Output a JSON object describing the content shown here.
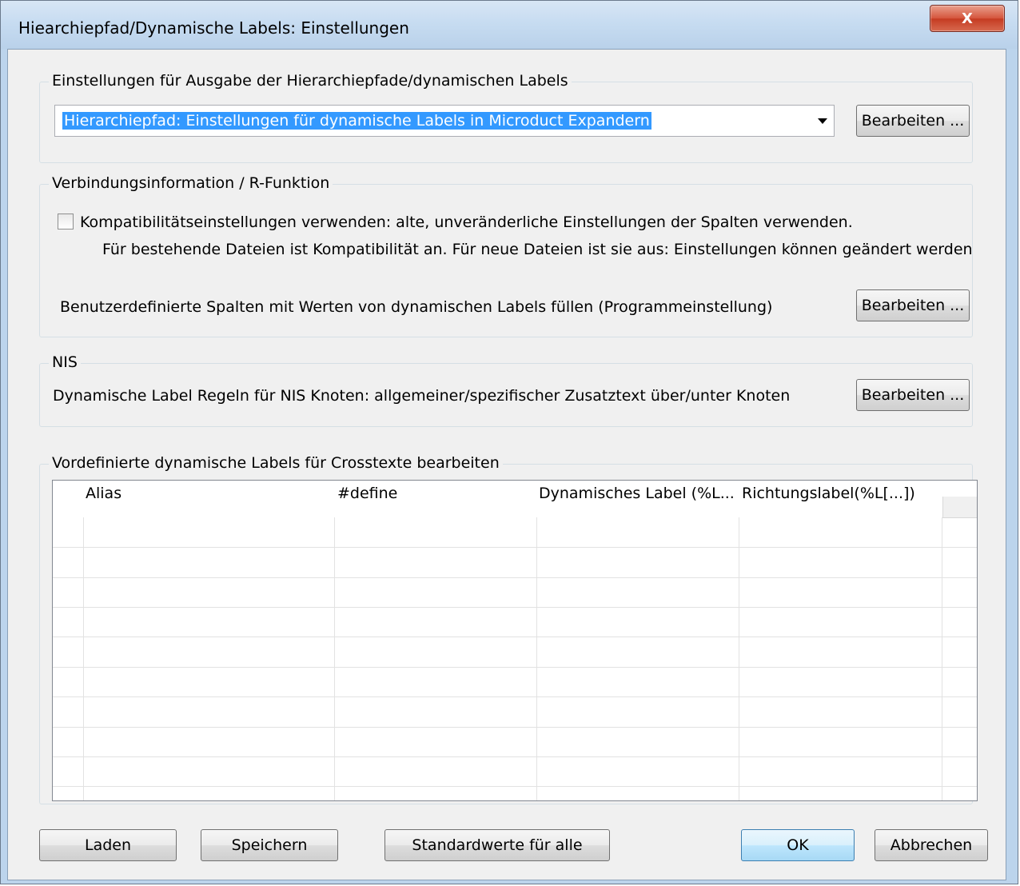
{
  "window": {
    "title": "Hiearchiepfad/Dynamische Labels: Einstellungen",
    "close_label": "X"
  },
  "output_group": {
    "label": "Einstellungen für Ausgabe der Hierarchiepfade/dynamischen Labels",
    "combo_value": "Hierarchiepfad: Einstellungen für dynamische Labels in Microduct Expandern",
    "edit_label": "Bearbeiten ..."
  },
  "connection_group": {
    "label": "Verbindungsinformation / R-Funktion",
    "compat_checkbox_label": "Kompatibilitätseinstellungen verwenden: alte, unveränderliche Einstellungen der Spalten verwenden.",
    "compat_checked": false,
    "compat_note": "Für bestehende Dateien ist Kompatibilität an. Für neue Dateien ist sie aus: Einstellungen können geändert werden",
    "custom_columns_text": "Benutzerdefinierte Spalten mit Werten von dynamischen Labels füllen (Programmeinstellung)",
    "edit_label": "Bearbeiten ..."
  },
  "nis_group": {
    "label": "NIS",
    "rules_text": "Dynamische Label Regeln für NIS Knoten: allgemeiner/spezifischer Zusatztext über/unter Knoten",
    "edit_label": "Bearbeiten ..."
  },
  "labels_group": {
    "label": "Vordefinierte dynamische Labels für Crosstexte bearbeiten",
    "columns": [
      "Alias",
      "#define",
      "Dynamisches Label (%L...",
      "Richtungslabel(%L[...])"
    ],
    "rows": []
  },
  "footer": {
    "load_label": "Laden",
    "save_label": "Speichern",
    "defaults_label": "Standardwerte für alle",
    "ok_label": "OK",
    "cancel_label": "Abbrechen"
  }
}
